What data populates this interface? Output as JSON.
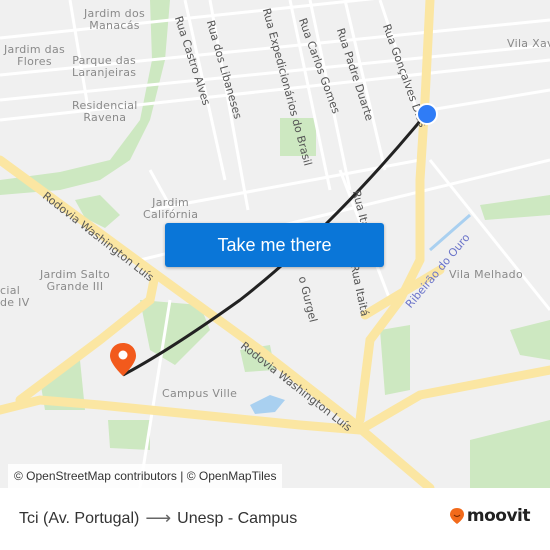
{
  "map": {
    "neighborhoods": [
      {
        "id": "jardim-dos-manacas",
        "lines": [
          "Jardim dos",
          "Manacás"
        ]
      },
      {
        "id": "jardim-das-flores",
        "lines": [
          "Jardim das",
          "Flores"
        ]
      },
      {
        "id": "parque-das-laranjeiras",
        "lines": [
          "Parque das",
          "Laranjeiras"
        ]
      },
      {
        "id": "residencial-ravena",
        "lines": [
          "Residencial",
          "Ravena"
        ]
      },
      {
        "id": "vila-xavier",
        "lines": [
          "Vila Xav"
        ]
      },
      {
        "id": "jardim-california",
        "lines": [
          "Jardim",
          "Califórnia"
        ]
      },
      {
        "id": "jardim-salto-grande-iii",
        "lines": [
          "Jardim Salto",
          "Grande III"
        ]
      },
      {
        "id": "residencial-iv",
        "lines": [
          "cial",
          "de IV"
        ]
      },
      {
        "id": "vila-melhado",
        "lines": [
          "Vila Melhado"
        ]
      },
      {
        "id": "campus-ville",
        "lines": [
          "Campus Ville"
        ]
      }
    ],
    "streets": [
      "Rua Castro Alves",
      "Rua dos Libaneses",
      "Rua Expedicionários do Brasil",
      "Rua Carlos Gomes",
      "Rua Padre Duarte",
      "Rua Gonçalves Dias",
      "Rua Itália",
      "Rua Itaitá",
      "o Gurgel",
      "Rodovia Washington Luís",
      "Rodovia Washington Luís"
    ],
    "waterways": [
      "Ribeirão do Ouro"
    ],
    "origin_marker": {
      "icon": "origin-dot-icon",
      "color": "#2f7cf6"
    },
    "destination_marker": {
      "icon": "destination-pin-icon",
      "color": "#f25a1c"
    },
    "route_color": "#222222",
    "attribution": "© OpenStreetMap contributors | © OpenMapTiles"
  },
  "cta": {
    "label": "Take me there",
    "color": "#0a76d8"
  },
  "footer": {
    "origin": "Tci (Av. Portugal)",
    "arrow_icon": "arrow-right-icon",
    "destination": "Unesp - Campus",
    "brand": "moovit",
    "brand_icon": "moovit-logo-icon",
    "brand_color": "#f26a1b"
  }
}
